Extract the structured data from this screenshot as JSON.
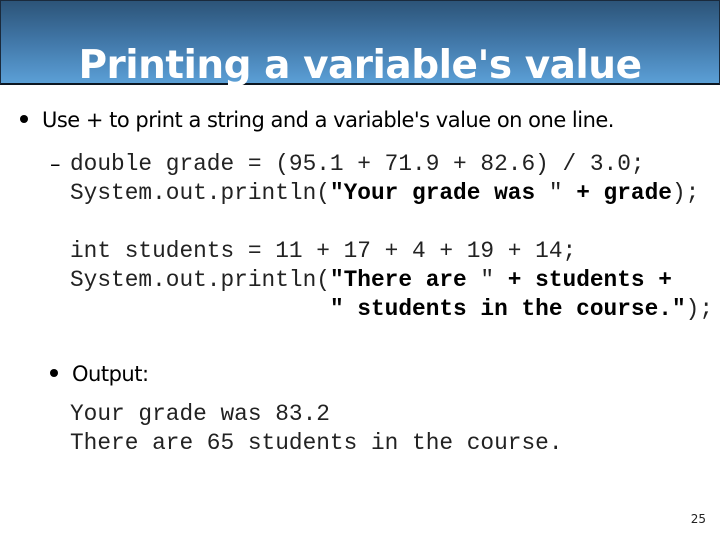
{
  "slide": {
    "title": "Printing a variable's value",
    "page_number": "25"
  },
  "bullets": [
    {
      "text": "Use + to print a string and a variable's value on one line."
    },
    {
      "text": "Output:"
    }
  ],
  "sub_bullet_marker": "–",
  "code_block_1": {
    "line1": "double grade = (95.1 + 71.9 + 82.6) / 3.0;",
    "line2": {
      "pre": "System.out.println(",
      "bold1": "\"Your grade was ",
      "mid": "\"",
      "bold2": " + grade",
      "post": ");"
    },
    "line3": "int students = 11 + 17 + 4 + 19 + 14;",
    "line4": {
      "pre": "System.out.println(",
      "bold1": "\"There are ",
      "mid": "\"",
      "bold2": " + students +"
    },
    "line5": {
      "indent": "                   ",
      "bold": "\" students in the course.\"",
      "post": ");"
    }
  },
  "output_block": {
    "lines": [
      "Your grade was 83.2",
      "There are 65 students in the course."
    ]
  }
}
